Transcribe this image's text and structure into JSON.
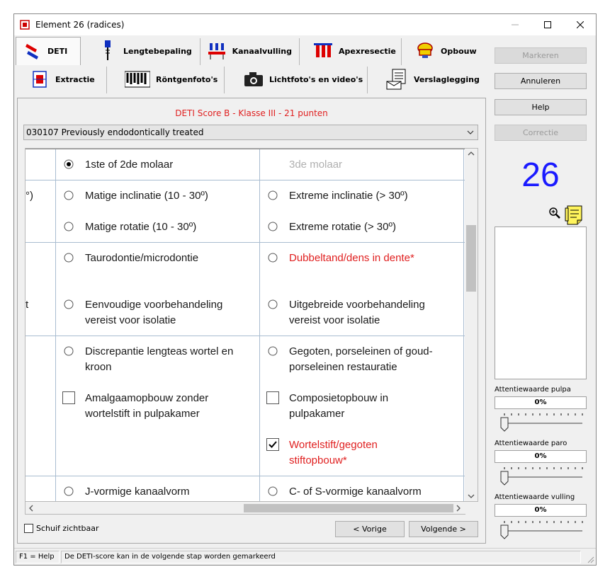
{
  "window": {
    "title": "Element 26 (radices)"
  },
  "tabs_row1": [
    {
      "label": "DETI",
      "icon": "tooth-icon",
      "active": true
    },
    {
      "label": "Lengtebepaling",
      "icon": "file-instrument-icon"
    },
    {
      "label": "Kanaalvulling",
      "icon": "canal-filling-icon"
    },
    {
      "label": "Apexresectie",
      "icon": "apex-resection-icon"
    },
    {
      "label": "Opbouw",
      "icon": "buildup-icon"
    }
  ],
  "tabs_row2": [
    {
      "label": "Extractie",
      "icon": "extraction-icon"
    },
    {
      "label": "Röntgenfoto's",
      "icon": "xray-icon"
    },
    {
      "label": "Lichtfoto's en video's",
      "icon": "camera-icon"
    },
    {
      "label": "Verslaglegging",
      "icon": "report-icon"
    }
  ],
  "right_panel": {
    "markeren": "Markeren",
    "annuleren": "Annuleren",
    "help": "Help",
    "correctie": "Correctie",
    "tooth_number": "26",
    "att_pulpa_label": "Attentiewaarde pulpa",
    "att_pulpa_value": "0%",
    "att_paro_label": "Attentiewaarde paro",
    "att_paro_value": "0%",
    "att_vulling_label": "Attentiewaarde vulling",
    "att_vulling_value": "0%"
  },
  "main": {
    "score": "DETI Score B - Klasse III - 21 punten",
    "dropdown_value": "030107 Previously endodontically treated",
    "left_fragment_1": "°)",
    "left_fragment_2": "t",
    "options": {
      "molaar_12": "1ste of 2de molaar",
      "molaar_3": "3de molaar",
      "matige_inclinatie": "Matige inclinatie (10 - 30º)",
      "extreme_inclinatie": "Extreme inclinatie (> 30º)",
      "matige_rotatie": "Matige rotatie (10 - 30º)",
      "extreme_rotatie": "Extreme rotatie (> 30º)",
      "taurodontie": "Taurodontie/microdontie",
      "dubbeltand": "Dubbeltand/dens in dente*",
      "eenvoudige_1": "Eenvoudige voorbehandeling",
      "eenvoudige_2": "vereist voor isolatie",
      "uitgebreide_1": "Uitgebreide voorbehandeling",
      "uitgebreide_2": "vereist voor isolatie",
      "discrepantie_1": "Discrepantie lengteas wortel en",
      "discrepantie_2": "kroon",
      "gegoten_1": "Gegoten, porseleinen of goud-",
      "gegoten_2": "porseleinen restauratie",
      "amalgaam_1": "Amalgaamopbouw zonder",
      "amalgaam_2": "wortelstift in pulpakamer",
      "composiet_1": "Composietopbouw in",
      "composiet_2": "pulpakamer",
      "wortelstift_1": "Wortelstift/gegoten",
      "wortelstift_2": "stiftopbouw*",
      "j_vormig": "J-vormige kanaalvorm",
      "c_vormig": "C- of S-vormige kanaalvorm"
    },
    "schuif_zichtbaar": "Schuif zichtbaar",
    "vorige": "< Vorige",
    "volgende": "Volgende >"
  },
  "status": {
    "help": "F1 = Help",
    "message": "De DETI-score kan in de volgende stap worden gemarkeerd"
  },
  "colors": {
    "accent_red": "#e02020",
    "tooth_blue": "#1a1aff"
  }
}
